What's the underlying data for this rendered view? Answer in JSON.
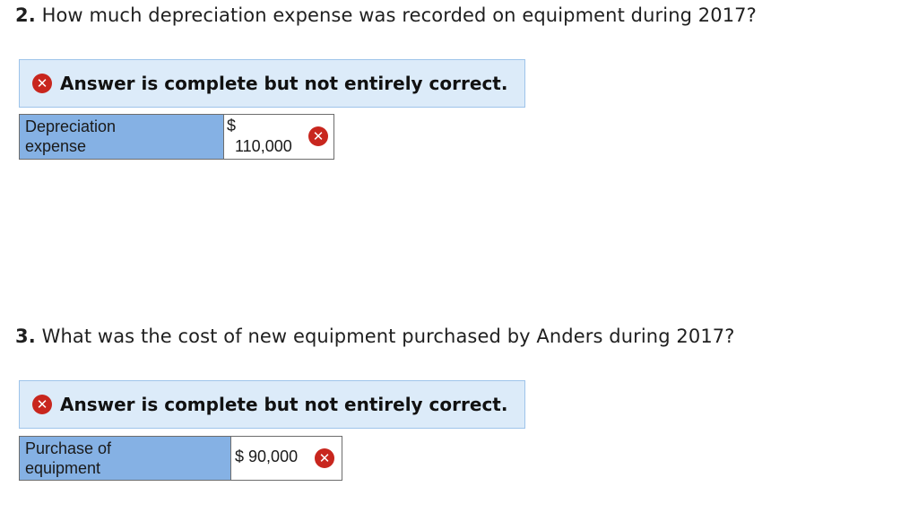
{
  "question2": {
    "number": "2.",
    "text": "How much depreciation expense was recorded on equipment during 2017?",
    "banner": {
      "icon": "x-circle-icon",
      "text": "Answer is complete but not entirely correct."
    },
    "row": {
      "label_line1": "Depreciation",
      "label_line2": "expense",
      "currency": "$",
      "value": "110,000",
      "status_icon": "x-circle-icon"
    }
  },
  "question3": {
    "number": "3.",
    "text": "What was the cost of new equipment purchased by Anders during 2017?",
    "banner": {
      "icon": "x-circle-icon",
      "text": "Answer is complete but not entirely correct."
    },
    "row": {
      "label_line1": "Purchase of",
      "label_line2": "equipment",
      "currency": "$",
      "value": "90,000",
      "status_icon": "x-circle-icon"
    }
  },
  "colors": {
    "banner_bg": "#dcebf9",
    "banner_border": "#9ec4ea",
    "label_cell_bg": "#85b1e4",
    "error_red": "#c8261e"
  }
}
